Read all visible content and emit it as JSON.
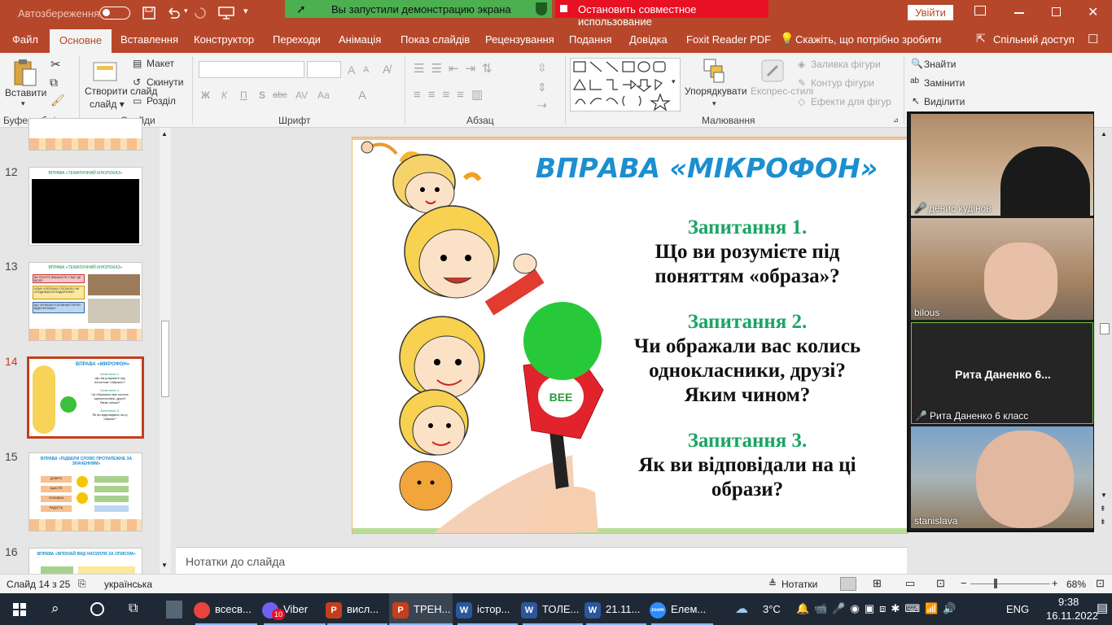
{
  "titlebar": {
    "autosave_label": "Автозбереження",
    "share_banner": "Вы запустили демонстрацию экрана",
    "stop_share": "Остановить совместное использование",
    "signin_button": "Увійти"
  },
  "tabs": [
    "Файл",
    "Основне",
    "Вставлення",
    "Конструктор",
    "Переходи",
    "Анімація",
    "Показ слайдів",
    "Рецензування",
    "Подання",
    "Довідка",
    "Foxit Reader PDF",
    "Скажіть, що потрібно зробити",
    "Спільний доступ"
  ],
  "active_tab": "Основне",
  "ribbon": {
    "paste": "Вставити",
    "clipboard_group": "Буфер обміну",
    "new_slide": "Створити слайд",
    "layout": "Макет",
    "reset": "Скинути",
    "section": "Розділ",
    "slides_group": "Слайди",
    "font_group": "Шрифт",
    "bold": "Ж",
    "italic": "К",
    "underline": "П",
    "strike": "abc",
    "case": "Аа",
    "paragraph_group": "Абзац",
    "arrange": "Упорядкувати",
    "quick_styles": "Експрес-стилі",
    "shape_fill": "Заливка фігури",
    "shape_outline": "Контур фігури",
    "shape_effects": "Ефекти для фігур",
    "drawing_group": "Малювання",
    "find": "Знайти",
    "replace": "Замінити",
    "select": "Виділити"
  },
  "thumbnails": [
    {
      "num": "12",
      "title": "ВПРАВА «ТЕМАТИЧНИЙ КІНОПОКАЗ»"
    },
    {
      "num": "13",
      "title": "ВПРАВА «ТЕМАТИЧНИЙ КІНОПОКАЗ»"
    },
    {
      "num": "14",
      "title": "ВПРАВА «МІКРОФОН»"
    },
    {
      "num": "15",
      "title": "ВПРАВА «ПІДБЕРИ СЛОВО ПРОТИЛЕЖНЕ ЗА ЗНАЧЕННЯМ»"
    },
    {
      "num": "16",
      "title": "ВПРАВА «ВПІЗНАЙ ВИД НАСИЛЛЯ ЗА ОПИСОМ»"
    }
  ],
  "thumb15_words": [
    "ДОБРО",
    "ЩАСТЯ",
    "УСМІШКА",
    "РАДІСТЬ"
  ],
  "thumb13_questions": [
    "ВИ ПОЧУТЕ ВВАЖАЄТЕ У ВАС ЦЕ ВЕЗЕ?",
    "ЧОМУ ХЛОПЧИКУ СПОЧАТКУ НЕ СПОДОБАЄСЯ ПОДАРУНОК?",
    "ЩО ЗРОБИЛИ ГОЛОВНИЙ ГЕРОЙ ВІДЕОРОЛИКА?"
  ],
  "slide": {
    "title": "ВПРАВА «МІКРОФОН»",
    "q1_label": "Запитання 1.",
    "q1_line1": "Що ви розумієте під",
    "q1_line2": "поняттям «образа»?",
    "q2_label": "Запитання 2.",
    "q2_line1": "Чи ображали вас колись",
    "q2_line2": "однокласники, друзі?",
    "q2_line3": "Яким чином?",
    "q3_label": "Запитання 3.",
    "q3_line1": "Як ви відповідали на ці",
    "q3_line2": "образи?",
    "mic_logo": "ВЕЕ"
  },
  "notes_placeholder": "Нотатки до слайда",
  "participants": [
    {
      "name": "денис кудінов",
      "muted": true
    },
    {
      "name": "bilous",
      "muted": false
    },
    {
      "name": "Рита Даненко 6 класс",
      "center_name": "Рита Даненко 6...",
      "muted": true
    },
    {
      "name": "stanislava",
      "muted": false
    }
  ],
  "status": {
    "slide": "Слайд 14 з 25",
    "language": "українська",
    "notes": "Нотатки",
    "zoom": "68%"
  },
  "taskbar": {
    "items": [
      "всесв...",
      "Viber",
      "висл...",
      "ТРЕН...",
      "істор...",
      "ТОЛЕ...",
      "21.11...",
      "Елем..."
    ],
    "viber_badge": "10",
    "weather": "3°C",
    "lang": "ENG",
    "time": "9:38",
    "date": "16.11.2022"
  },
  "colors": {
    "accent": "#b7472a",
    "question_label": "#1aa564",
    "slide_title": "#1b8fd0",
    "share_green": "#4caf50",
    "stop_red": "#e81123"
  }
}
